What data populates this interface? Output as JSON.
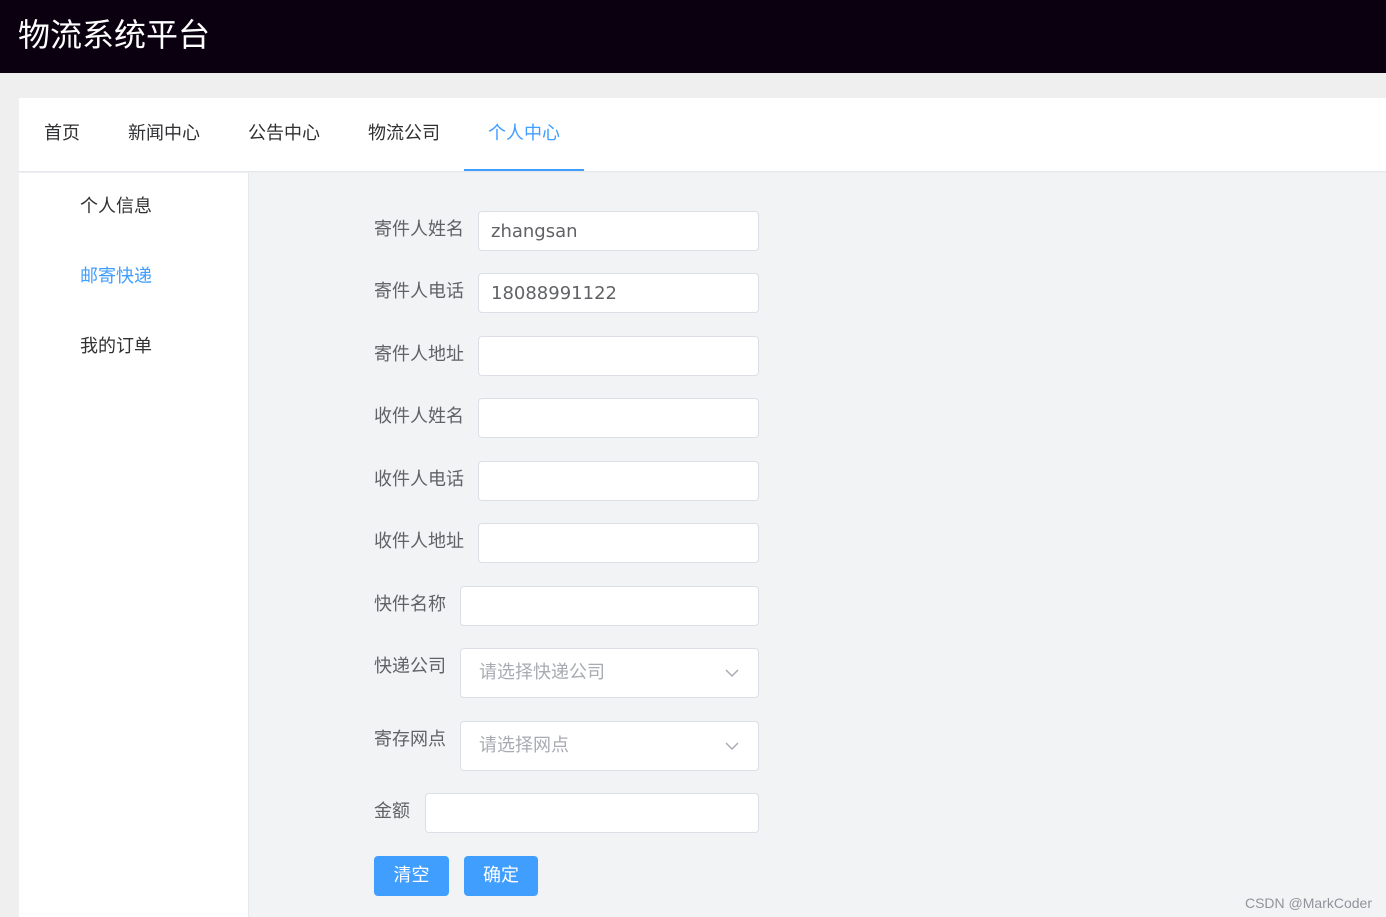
{
  "header": {
    "title": "物流系统平台"
  },
  "nav": {
    "items": [
      {
        "label": "首页"
      },
      {
        "label": "新闻中心"
      },
      {
        "label": "公告中心"
      },
      {
        "label": "物流公司"
      },
      {
        "label": "个人中心"
      }
    ],
    "active_index": 4
  },
  "sidebar": {
    "items": [
      {
        "label": "个人信息"
      },
      {
        "label": "邮寄快递"
      },
      {
        "label": "我的订单"
      }
    ],
    "active_index": 1
  },
  "form": {
    "sender_name": {
      "label": "寄件人姓名",
      "value": "zhangsan"
    },
    "sender_phone": {
      "label": "寄件人电话",
      "value": "18088991122"
    },
    "sender_address": {
      "label": "寄件人地址",
      "value": ""
    },
    "receiver_name": {
      "label": "收件人姓名",
      "value": ""
    },
    "receiver_phone": {
      "label": "收件人电话",
      "value": ""
    },
    "receiver_address": {
      "label": "收件人地址",
      "value": ""
    },
    "item_name": {
      "label": "快件名称",
      "value": ""
    },
    "courier_company": {
      "label": "快递公司",
      "placeholder": "请选择快递公司"
    },
    "dropoff_point": {
      "label": "寄存网点",
      "placeholder": "请选择网点"
    },
    "amount": {
      "label": "金额",
      "value": ""
    },
    "clear_label": "清空",
    "submit_label": "确定"
  },
  "watermark": "CSDN @MarkCoder",
  "icons": {
    "select_arrow": "chevron-down-icon"
  },
  "colors": {
    "accent": "#409eff",
    "header_bg": "#0a0010",
    "content_bg": "#f2f3f5"
  }
}
